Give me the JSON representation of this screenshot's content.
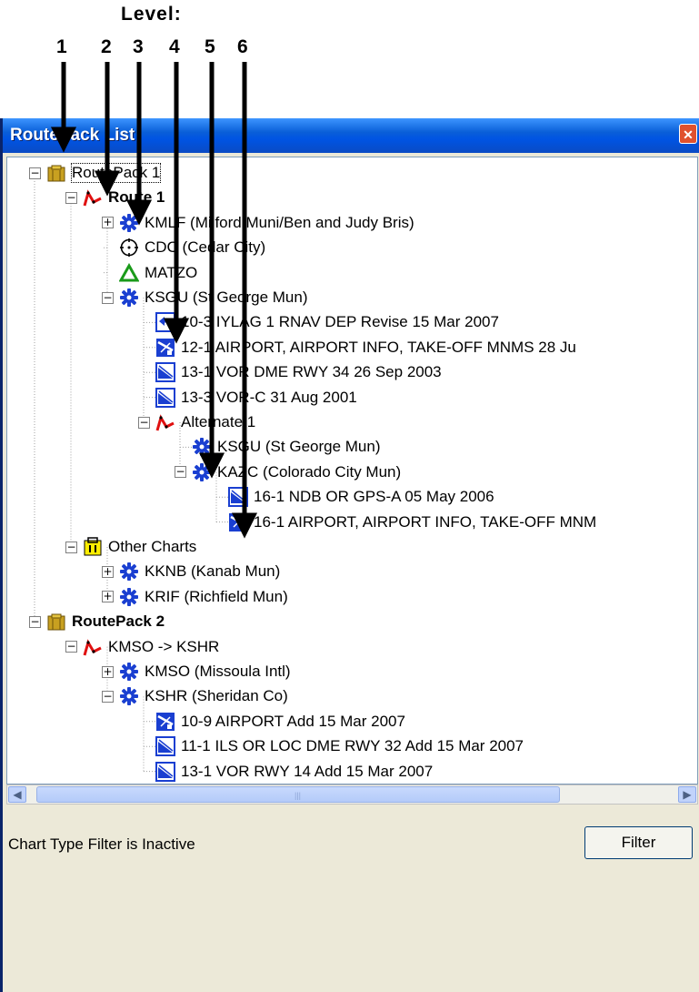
{
  "annotation": {
    "title": "Level:",
    "levels": [
      "1",
      "2",
      "3",
      "4",
      "5",
      "6"
    ]
  },
  "window": {
    "title": "RoutePack List",
    "close_glyph": "✕"
  },
  "tree": {
    "routepack1": {
      "label": "RoutePack 1",
      "icon": "routepack-icon"
    },
    "route1": {
      "label": "Route 1",
      "icon": "route-icon"
    },
    "kmlf": {
      "label": "KMLF (Milford Muni/Ben and Judy Bris)",
      "icon": "airport-icon"
    },
    "cdc": {
      "label": "CDC (Cedar City)",
      "icon": "vor-icon"
    },
    "matzo": {
      "label": "MATZO",
      "icon": "waypoint-icon"
    },
    "ksgu": {
      "label": "KSGU (St George Mun)",
      "icon": "airport-icon"
    },
    "ksgu_c1": {
      "label": "10-3  IYLAG 1 RNAV DEP   Revise 15 Mar 2007",
      "icon": "departure-chart-icon"
    },
    "ksgu_c2": {
      "label": "12-1  AIRPORT, AIRPORT INFO, TAKE-OFF MNMS   28 Ju",
      "icon": "airport-chart-icon"
    },
    "ksgu_c3": {
      "label": "13-1  VOR DME RWY 34   26 Sep 2003",
      "icon": "approach-chart-icon"
    },
    "ksgu_c4": {
      "label": "13-3  VOR-C   31 Aug 2001",
      "icon": "approach-chart-icon"
    },
    "alternate1": {
      "label": "Alternate 1",
      "icon": "route-icon"
    },
    "alt_ksgu": {
      "label": "KSGU (St George Mun)",
      "icon": "airport-icon"
    },
    "kazc": {
      "label": "KAZC (Colorado City Mun)",
      "icon": "airport-icon"
    },
    "kazc_c1": {
      "label": "16-1  NDB OR GPS-A   05 May 2006",
      "icon": "approach-chart-icon"
    },
    "kazc_c2": {
      "label": "16-1  AIRPORT, AIRPORT INFO, TAKE-OFF MNM",
      "icon": "airport-chart-icon"
    },
    "other": {
      "label": "Other Charts",
      "icon": "other-charts-icon"
    },
    "kknb": {
      "label": "KKNB (Kanab Mun)",
      "icon": "airport-icon"
    },
    "krif": {
      "label": "KRIF (Richfield Mun)",
      "icon": "airport-icon"
    },
    "routepack2": {
      "label": "RoutePack 2",
      "icon": "routepack-icon"
    },
    "kmso_kshr": {
      "label": "KMSO -> KSHR",
      "icon": "route-icon"
    },
    "kmso": {
      "label": "KMSO (Missoula Intl)",
      "icon": "airport-icon"
    },
    "kshr": {
      "label": "KSHR (Sheridan Co)",
      "icon": "airport-icon"
    },
    "kshr_c1": {
      "label": "10-9  AIRPORT   Add 15 Mar 2007",
      "icon": "airport-chart-icon"
    },
    "kshr_c2": {
      "label": "11-1  ILS OR LOC DME RWY 32   Add 15 Mar 2007",
      "icon": "approach-chart-icon"
    },
    "kshr_c3": {
      "label": "13-1  VOR RWY 14   Add 15 Mar 2007",
      "icon": "approach-chart-icon"
    },
    "expander_open": "−",
    "expander_closed": "+"
  },
  "status": {
    "text": "Chart Type Filter is Inactive",
    "filter_button": "Filter"
  },
  "scrollbar": {
    "left_glyph": "◀",
    "right_glyph": "▶",
    "grip": "|||"
  },
  "colors": {
    "titlebar": "#0054e3",
    "airport_icon": "#1a3fd1",
    "route_icon": "#e01010",
    "waypoint_icon": "#1a9a1a"
  }
}
